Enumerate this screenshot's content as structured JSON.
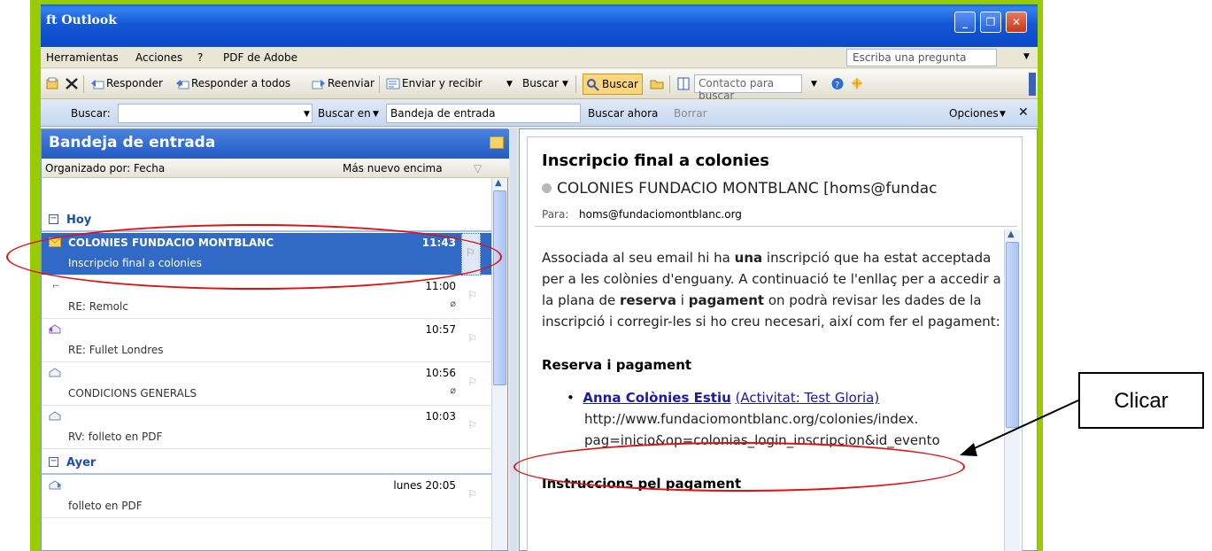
{
  "window": {
    "title": "ft Outlook"
  },
  "titlebar_buttons": {
    "minimize": "_",
    "maximize": "❐",
    "close": "✕"
  },
  "menu": {
    "items": [
      "Herramientas",
      "Acciones",
      "?",
      "PDF de Adobe"
    ],
    "ask_placeholder": "Escriba una pregunta"
  },
  "toolbar": {
    "reply": "Responder",
    "reply_all": "Responder a todos",
    "forward": "Reenviar",
    "send_receive": "Enviar y recibir",
    "find": "Buscar",
    "find_active": "Buscar",
    "contact_placeholder": "Contacto para buscar"
  },
  "searchbar": {
    "label": "Buscar:",
    "search_in": "Buscar en",
    "folder": "Bandeja de entrada",
    "search_now": "Buscar ahora",
    "clear": "Borrar",
    "options": "Opciones"
  },
  "list": {
    "title": "Bandeja de entrada",
    "arranged_by": "Organizado por: Fecha",
    "sort": "Más nuevo encima",
    "groups": {
      "today": "Hoy",
      "yesterday": "Ayer"
    },
    "messages": [
      {
        "from": "COLONIES FUNDACIO MONTBLANC",
        "subject": "Inscripcio final a colonies",
        "time": "11:43",
        "attachment": false
      },
      {
        "from": "",
        "subject": "RE: Remolc",
        "time": "11:00",
        "attachment": true
      },
      {
        "from": "",
        "subject": "RE: Fullet Londres",
        "time": "10:57",
        "attachment": false
      },
      {
        "from": "",
        "subject": "CONDICIONS GENERALS",
        "time": "10:56",
        "attachment": true
      },
      {
        "from": "",
        "subject": "RV: folleto en PDF",
        "time": "10:03",
        "attachment": false
      },
      {
        "from": "",
        "subject": "folleto en PDF",
        "time": "lunes 20:05",
        "attachment": false
      }
    ]
  },
  "reading": {
    "subject": "Inscripcio final a colonies",
    "sender": "COLONIES FUNDACIO MONTBLANC [homs@fundac",
    "to_label": "Para:",
    "to": "homs@fundaciomontblanc.org",
    "body": {
      "p1_a": "Associada al seu email hi ha ",
      "p1_b": "una",
      "p1_c": " inscripció que ha estat acceptada per a les colònies d'enguany. A continuació te l'enllaç per a accedir a la plana de ",
      "p1_d": "reserva",
      "p1_e": " i ",
      "p1_f": "pagament",
      "p1_g": " on podrà revisar les dades de la inscripció i corregir-les si ho creu necesari, així com fer el pagament:",
      "heading1": "Reserva i pagament",
      "link_name": "Anna Colònies Estiu",
      "link_activity": "(Activitat: Test Gloria)",
      "url1": "http://www.fundaciomontblanc.org/colonies/index.",
      "url2": "pag=inicio&op=colonias_login_inscripcion&id_evento",
      "heading2": "Instruccions pel pagament"
    }
  },
  "annotation": {
    "callout": "Clicar"
  },
  "colors": {
    "accent": "#3169c6",
    "highlight_ring": "#e01010",
    "frame": "#99cc00"
  }
}
